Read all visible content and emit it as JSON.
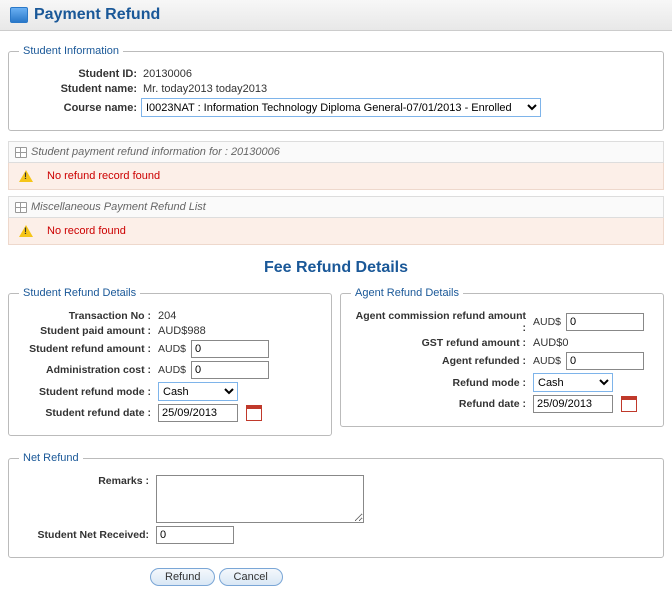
{
  "page_title": "Payment Refund",
  "student_info": {
    "legend": "Student Information",
    "id_label": "Student ID:",
    "id_value": "20130006",
    "name_label": "Student name:",
    "name_value": "Mr. today2013 today2013",
    "course_label": "Course name:",
    "course_value": "I0023NAT : Information Technology Diploma General-07/01/2013 - Enrolled"
  },
  "sections": {
    "refund_list_title": "Student payment refund information for : 20130006",
    "refund_list_msg": "No refund record found",
    "misc_list_title": "Miscellaneous Payment Refund List",
    "misc_list_msg": "No record found"
  },
  "details_heading": "Fee Refund Details",
  "student_details": {
    "legend": "Student Refund Details",
    "txn_label": "Transaction No :",
    "txn_value": "204",
    "paid_label": "Student paid amount :",
    "paid_value": "AUD$988",
    "refund_amt_label": "Student refund amount :",
    "refund_amt_value": "0",
    "admin_cost_label": "Administration cost :",
    "admin_cost_value": "0",
    "mode_label": "Student refund mode :",
    "mode_value": "Cash",
    "date_label": "Student refund date :",
    "date_value": "25/09/2013"
  },
  "agent_details": {
    "legend": "Agent Refund Details",
    "comm_label": "Agent commission refund amount :",
    "comm_value": "0",
    "gst_label": "GST refund amount :",
    "gst_value": "AUD$0",
    "refunded_label": "Agent refunded :",
    "refunded_value": "0",
    "mode_label": "Refund mode :",
    "mode_value": "Cash",
    "date_label": "Refund date :",
    "date_value": "25/09/2013"
  },
  "net_refund": {
    "legend": "Net Refund",
    "remarks_label": "Remarks :",
    "remarks_value": "",
    "net_label": "Student Net Received:",
    "net_value": "0"
  },
  "currency_prefix": "AUD$",
  "buttons": {
    "refund": "Refund",
    "cancel": "Cancel"
  }
}
